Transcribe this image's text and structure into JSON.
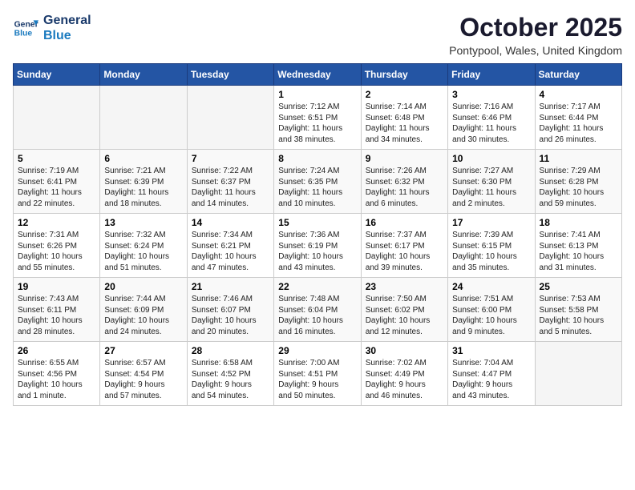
{
  "logo": {
    "text_general": "General",
    "text_blue": "Blue"
  },
  "header": {
    "month": "October 2025",
    "location": "Pontypool, Wales, United Kingdom"
  },
  "weekdays": [
    "Sunday",
    "Monday",
    "Tuesday",
    "Wednesday",
    "Thursday",
    "Friday",
    "Saturday"
  ],
  "weeks": [
    [
      {
        "day": "",
        "content": ""
      },
      {
        "day": "",
        "content": ""
      },
      {
        "day": "",
        "content": ""
      },
      {
        "day": "1",
        "content": "Sunrise: 7:12 AM\nSunset: 6:51 PM\nDaylight: 11 hours\nand 38 minutes."
      },
      {
        "day": "2",
        "content": "Sunrise: 7:14 AM\nSunset: 6:48 PM\nDaylight: 11 hours\nand 34 minutes."
      },
      {
        "day": "3",
        "content": "Sunrise: 7:16 AM\nSunset: 6:46 PM\nDaylight: 11 hours\nand 30 minutes."
      },
      {
        "day": "4",
        "content": "Sunrise: 7:17 AM\nSunset: 6:44 PM\nDaylight: 11 hours\nand 26 minutes."
      }
    ],
    [
      {
        "day": "5",
        "content": "Sunrise: 7:19 AM\nSunset: 6:41 PM\nDaylight: 11 hours\nand 22 minutes."
      },
      {
        "day": "6",
        "content": "Sunrise: 7:21 AM\nSunset: 6:39 PM\nDaylight: 11 hours\nand 18 minutes."
      },
      {
        "day": "7",
        "content": "Sunrise: 7:22 AM\nSunset: 6:37 PM\nDaylight: 11 hours\nand 14 minutes."
      },
      {
        "day": "8",
        "content": "Sunrise: 7:24 AM\nSunset: 6:35 PM\nDaylight: 11 hours\nand 10 minutes."
      },
      {
        "day": "9",
        "content": "Sunrise: 7:26 AM\nSunset: 6:32 PM\nDaylight: 11 hours\nand 6 minutes."
      },
      {
        "day": "10",
        "content": "Sunrise: 7:27 AM\nSunset: 6:30 PM\nDaylight: 11 hours\nand 2 minutes."
      },
      {
        "day": "11",
        "content": "Sunrise: 7:29 AM\nSunset: 6:28 PM\nDaylight: 10 hours\nand 59 minutes."
      }
    ],
    [
      {
        "day": "12",
        "content": "Sunrise: 7:31 AM\nSunset: 6:26 PM\nDaylight: 10 hours\nand 55 minutes."
      },
      {
        "day": "13",
        "content": "Sunrise: 7:32 AM\nSunset: 6:24 PM\nDaylight: 10 hours\nand 51 minutes."
      },
      {
        "day": "14",
        "content": "Sunrise: 7:34 AM\nSunset: 6:21 PM\nDaylight: 10 hours\nand 47 minutes."
      },
      {
        "day": "15",
        "content": "Sunrise: 7:36 AM\nSunset: 6:19 PM\nDaylight: 10 hours\nand 43 minutes."
      },
      {
        "day": "16",
        "content": "Sunrise: 7:37 AM\nSunset: 6:17 PM\nDaylight: 10 hours\nand 39 minutes."
      },
      {
        "day": "17",
        "content": "Sunrise: 7:39 AM\nSunset: 6:15 PM\nDaylight: 10 hours\nand 35 minutes."
      },
      {
        "day": "18",
        "content": "Sunrise: 7:41 AM\nSunset: 6:13 PM\nDaylight: 10 hours\nand 31 minutes."
      }
    ],
    [
      {
        "day": "19",
        "content": "Sunrise: 7:43 AM\nSunset: 6:11 PM\nDaylight: 10 hours\nand 28 minutes."
      },
      {
        "day": "20",
        "content": "Sunrise: 7:44 AM\nSunset: 6:09 PM\nDaylight: 10 hours\nand 24 minutes."
      },
      {
        "day": "21",
        "content": "Sunrise: 7:46 AM\nSunset: 6:07 PM\nDaylight: 10 hours\nand 20 minutes."
      },
      {
        "day": "22",
        "content": "Sunrise: 7:48 AM\nSunset: 6:04 PM\nDaylight: 10 hours\nand 16 minutes."
      },
      {
        "day": "23",
        "content": "Sunrise: 7:50 AM\nSunset: 6:02 PM\nDaylight: 10 hours\nand 12 minutes."
      },
      {
        "day": "24",
        "content": "Sunrise: 7:51 AM\nSunset: 6:00 PM\nDaylight: 10 hours\nand 9 minutes."
      },
      {
        "day": "25",
        "content": "Sunrise: 7:53 AM\nSunset: 5:58 PM\nDaylight: 10 hours\nand 5 minutes."
      }
    ],
    [
      {
        "day": "26",
        "content": "Sunrise: 6:55 AM\nSunset: 4:56 PM\nDaylight: 10 hours\nand 1 minute."
      },
      {
        "day": "27",
        "content": "Sunrise: 6:57 AM\nSunset: 4:54 PM\nDaylight: 9 hours\nand 57 minutes."
      },
      {
        "day": "28",
        "content": "Sunrise: 6:58 AM\nSunset: 4:52 PM\nDaylight: 9 hours\nand 54 minutes."
      },
      {
        "day": "29",
        "content": "Sunrise: 7:00 AM\nSunset: 4:51 PM\nDaylight: 9 hours\nand 50 minutes."
      },
      {
        "day": "30",
        "content": "Sunrise: 7:02 AM\nSunset: 4:49 PM\nDaylight: 9 hours\nand 46 minutes."
      },
      {
        "day": "31",
        "content": "Sunrise: 7:04 AM\nSunset: 4:47 PM\nDaylight: 9 hours\nand 43 minutes."
      },
      {
        "day": "",
        "content": ""
      }
    ]
  ]
}
